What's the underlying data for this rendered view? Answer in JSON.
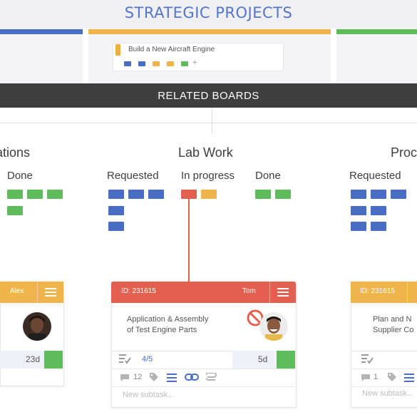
{
  "header": {
    "title": "STRATEGIC PROJECTS"
  },
  "epic_card": {
    "title": "Build a New Aircraft Engine"
  },
  "related": {
    "title": "RELATED BOARDS"
  },
  "boards": [
    {
      "title": "ations",
      "columns": [
        "Done"
      ]
    },
    {
      "title": "Lab Work",
      "columns": [
        "Requested",
        "In progress",
        "Done"
      ]
    },
    {
      "title": "Proc",
      "columns": [
        "Requested"
      ]
    }
  ],
  "cards": [
    {
      "owner": "Alex",
      "days": "23d"
    },
    {
      "id": "ID: 231615",
      "owner": "Tom",
      "title_line1": "Application & Assembly",
      "title_line2": "of Test Engine Parts",
      "checklist": "4/5",
      "days": "5d",
      "comments": "12",
      "subtask_placeholder": "New subtask..."
    },
    {
      "id": "ID: 231615",
      "title_line1": "Plan and N",
      "title_line2": "Supplier Co",
      "comments": "1",
      "subtask_placeholder": "New subtask..."
    }
  ],
  "colors": {
    "blue": "#4a6dc4",
    "green": "#5fbc5a",
    "yellow": "#f0b54a",
    "red": "#e35f4f",
    "dark": "#3e3e3e",
    "title_blue": "#5575c9"
  }
}
